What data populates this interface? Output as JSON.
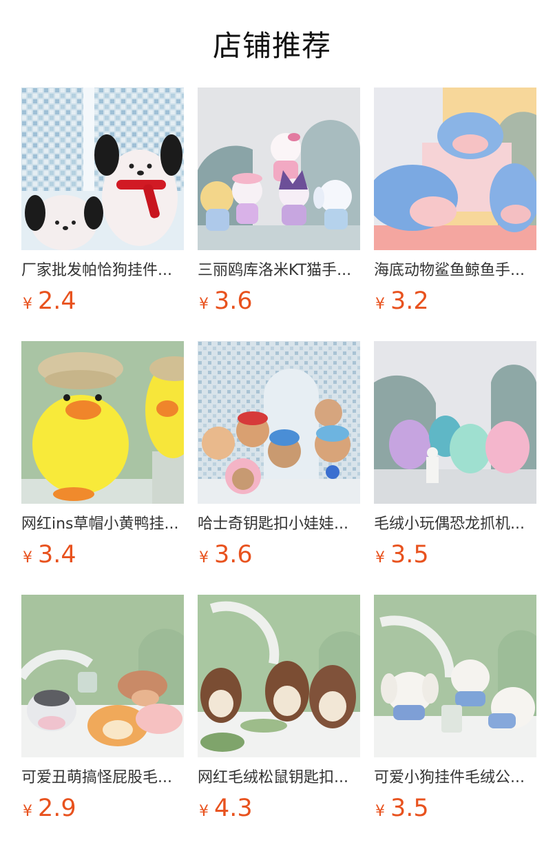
{
  "header": {
    "title": "店铺推荐"
  },
  "colors": {
    "price": "#e8521e",
    "title": "#111111",
    "name": "#333333"
  },
  "products": [
    {
      "name": "厂家批发帕恰狗挂件...",
      "currency": "¥",
      "price": "2.4",
      "scene": "tiles-blue",
      "icon": "pochacco-plush-image"
    },
    {
      "name": "三丽鸥库洛米KT猫手...",
      "currency": "¥",
      "price": "3.6",
      "scene": "arch-grey",
      "icon": "sanrio-plush-image"
    },
    {
      "name": "海底动物鲨鱼鲸鱼手...",
      "currency": "¥",
      "price": "3.2",
      "scene": "pastel",
      "icon": "shark-plush-image"
    },
    {
      "name": "网红ins草帽小黄鸭挂...",
      "currency": "¥",
      "price": "3.4",
      "scene": "green-duck",
      "icon": "duck-plush-image"
    },
    {
      "name": "哈士奇钥匙扣小娃娃...",
      "currency": "¥",
      "price": "3.6",
      "scene": "tiles-arch",
      "icon": "husky-plush-image"
    },
    {
      "name": "毛绒小玩偶恐龙抓机...",
      "currency": "¥",
      "price": "3.5",
      "scene": "arch-grey",
      "icon": "dinosaur-plush-image"
    },
    {
      "name": "可爱丑萌搞怪屁股毛...",
      "currency": "¥",
      "price": "2.9",
      "scene": "green-arch",
      "icon": "butt-plush-image"
    },
    {
      "name": "网红毛绒松鼠钥匙扣...",
      "currency": "¥",
      "price": "4.3",
      "scene": "green-arch",
      "icon": "squirrel-plush-image"
    },
    {
      "name": "可爱小狗挂件毛绒公...",
      "currency": "¥",
      "price": "3.5",
      "scene": "green-arch",
      "icon": "puppy-plush-image"
    }
  ]
}
